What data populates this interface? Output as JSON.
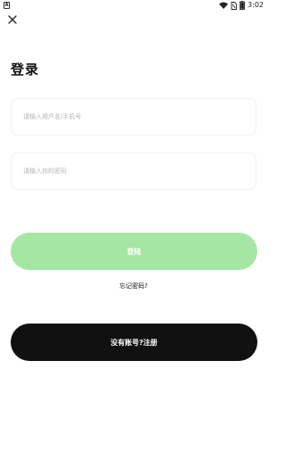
{
  "status_bar": {
    "time": "3:02",
    "icons": [
      "notification-icon",
      "wifi-icon",
      "no-sim-icon",
      "battery-icon"
    ]
  },
  "header": {
    "close_icon": "close-icon",
    "title": "登录"
  },
  "form": {
    "username_placeholder": "请输入用户名/手机号",
    "username_value": "",
    "password_placeholder": "请输入你的密码",
    "password_value": ""
  },
  "actions": {
    "login_label": "登陆",
    "forgot_label": "忘记密码?",
    "register_label": "没有账号?注册"
  },
  "colors": {
    "login_button_bg": "#a6e6a4",
    "register_button_bg": "#111111",
    "background": "#ffffff"
  }
}
